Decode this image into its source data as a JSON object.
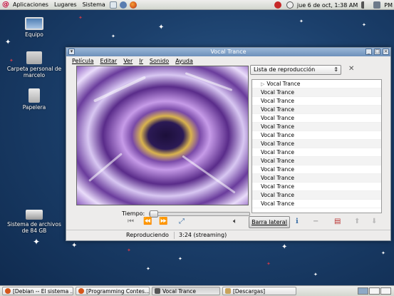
{
  "top_panel": {
    "menus": [
      "Aplicaciones",
      "Lugares",
      "Sistema"
    ],
    "clock": "jue  6 de oct,  1:38 AM",
    "user": "PM"
  },
  "desktop": {
    "icons": [
      {
        "label": "Equipo"
      },
      {
        "label": "Carpeta personal de marcelo"
      },
      {
        "label": "Papelera"
      },
      {
        "label": "Sistema de archivos de 84 GB"
      }
    ]
  },
  "player": {
    "title": "Vocal Trance",
    "menu": [
      "Película",
      "Editar",
      "Ver",
      "Ir",
      "Sonido",
      "Ayuda"
    ],
    "sidebar_select": "Lista de reproducción",
    "playlist": [
      "Vocal Trance",
      "Vocal Trance",
      "Vocal Trance",
      "Vocal Trance",
      "Vocal Trance",
      "Vocal Trance",
      "Vocal Trance",
      "Vocal Trance",
      "Vocal Trance",
      "Vocal Trance",
      "Vocal Trance",
      "Vocal Trance",
      "Vocal Trance",
      "Vocal Trance",
      "Vocal Trance"
    ],
    "time_label": "Tiempo:",
    "sidebar_button": "Barra lateral",
    "status": "Reproduciendo",
    "status_time": "3:24 (streaming)"
  },
  "taskbar": {
    "tasks": [
      {
        "label": "[Debian -- El sistema ..."
      },
      {
        "label": "[Programming Contes..."
      },
      {
        "label": "Vocal Trance"
      },
      {
        "label": "[Descargas]"
      }
    ]
  }
}
